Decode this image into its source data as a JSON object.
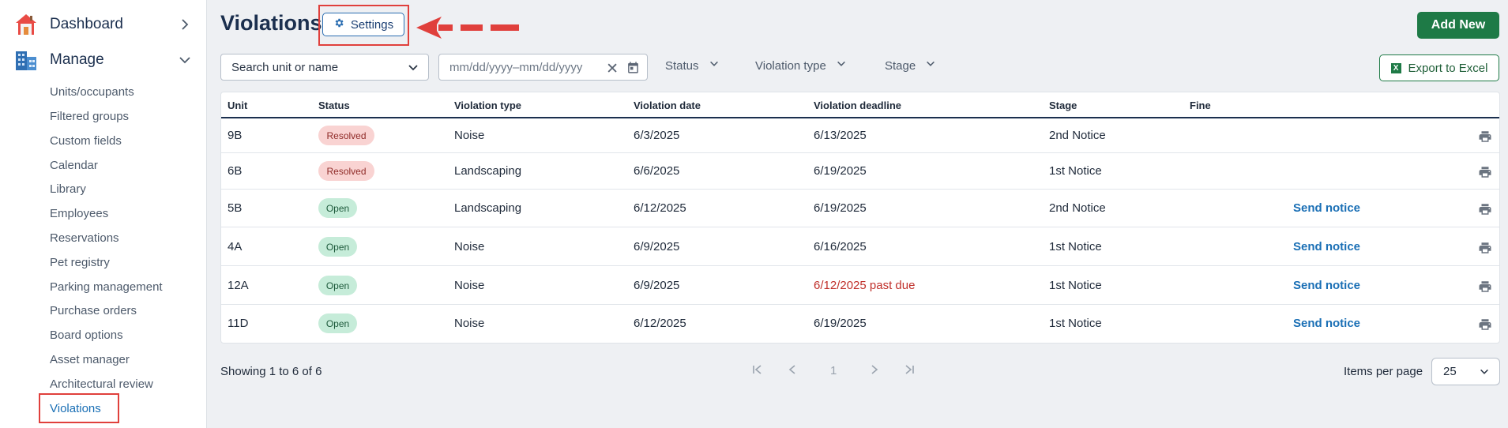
{
  "sidebar": {
    "dashboard_label": "Dashboard",
    "manage_label": "Manage",
    "items": [
      {
        "label": "Units/occupants"
      },
      {
        "label": "Filtered groups"
      },
      {
        "label": "Custom fields"
      },
      {
        "label": "Calendar"
      },
      {
        "label": "Library"
      },
      {
        "label": "Employees"
      },
      {
        "label": "Reservations"
      },
      {
        "label": "Pet registry"
      },
      {
        "label": "Parking management"
      },
      {
        "label": "Purchase orders"
      },
      {
        "label": "Board options"
      },
      {
        "label": "Asset manager"
      },
      {
        "label": "Architectural review"
      },
      {
        "label": "Violations",
        "active": true
      }
    ]
  },
  "header": {
    "title": "Violations",
    "settings_label": "Settings",
    "add_new_label": "Add New"
  },
  "filters": {
    "search_placeholder": "Search unit or name",
    "date_placeholder": "mm/dd/yyyy–mm/dd/yyyy",
    "status_label": "Status",
    "violation_type_label": "Violation type",
    "stage_label": "Stage",
    "export_label": "Export to Excel",
    "export_icon_letter": "X"
  },
  "table": {
    "headers": {
      "unit": "Unit",
      "status": "Status",
      "violation_type": "Violation type",
      "violation_date": "Violation date",
      "violation_deadline": "Violation deadline",
      "stage": "Stage",
      "fine": "Fine"
    },
    "rows": [
      {
        "unit": "9B",
        "status": "Resolved",
        "type": "Noise",
        "date": "6/3/2025",
        "deadline": "6/13/2025",
        "stage": "2nd Notice",
        "action": ""
      },
      {
        "unit": "6B",
        "status": "Resolved",
        "type": "Landscaping",
        "date": "6/6/2025",
        "deadline": "6/19/2025",
        "stage": "1st Notice",
        "action": ""
      },
      {
        "unit": "5B",
        "status": "Open",
        "type": "Landscaping",
        "date": "6/12/2025",
        "deadline": "6/19/2025",
        "stage": "2nd Notice",
        "action": "Send notice"
      },
      {
        "unit": "4A",
        "status": "Open",
        "type": "Noise",
        "date": "6/9/2025",
        "deadline": "6/16/2025",
        "stage": "1st Notice",
        "action": "Send notice"
      },
      {
        "unit": "12A",
        "status": "Open",
        "type": "Noise",
        "date": "6/9/2025",
        "deadline": "6/12/2025 past due",
        "stage": "1st Notice",
        "action": "Send notice"
      },
      {
        "unit": "11D",
        "status": "Open",
        "type": "Noise",
        "date": "6/12/2025",
        "deadline": "6/19/2025",
        "stage": "1st Notice",
        "action": "Send notice"
      }
    ]
  },
  "footer": {
    "showing_text": "Showing 1 to 6 of 6",
    "current_page": "1",
    "items_per_page_label": "Items per page",
    "items_per_page_value": "25"
  },
  "colors": {
    "primary_green": "#1e7a46",
    "link_blue": "#1a6fb5",
    "annotation_red": "#e0403c",
    "past_due_red": "#c0302b"
  }
}
